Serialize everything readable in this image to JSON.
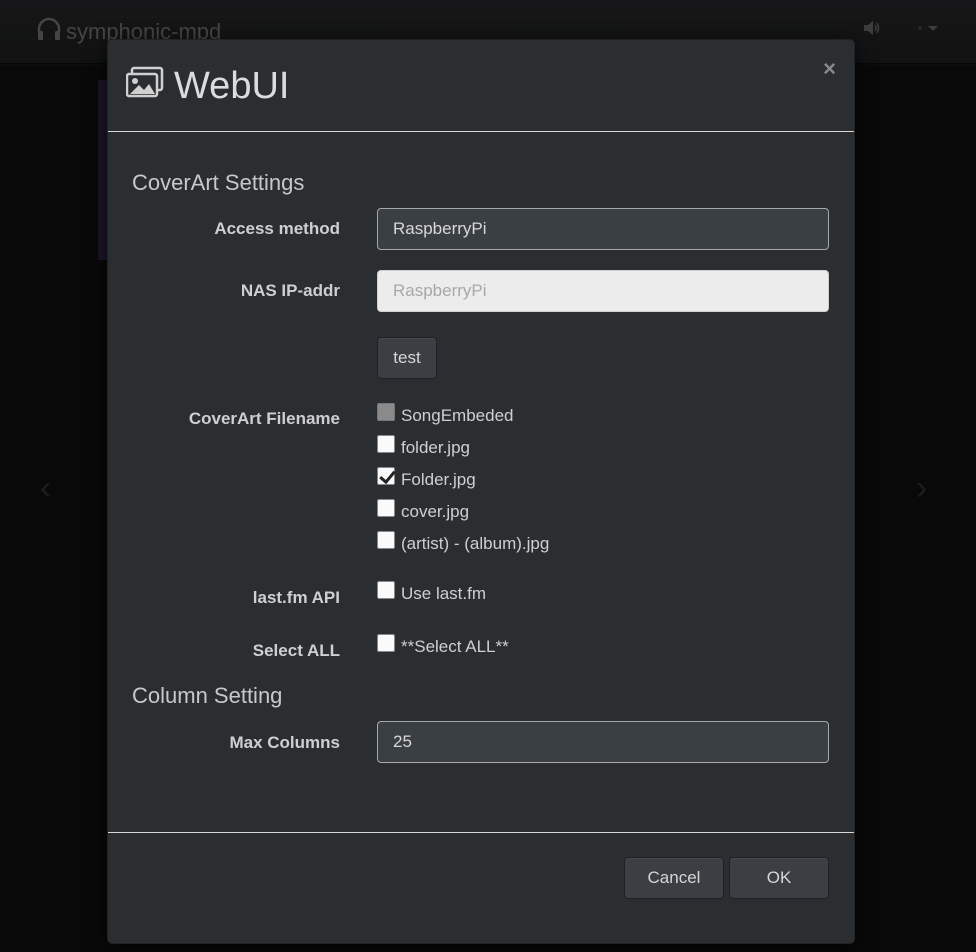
{
  "app": {
    "brand": "symphonic-mpd",
    "icons": [
      "headphones-icon",
      "volume-icon",
      "gear-icon"
    ]
  },
  "modal": {
    "title": "WebUI",
    "title_icon": "images-icon",
    "close_label": "×",
    "coverart_section": "CoverArt Settings",
    "access_method": {
      "label": "Access method",
      "value": "RaspberryPi"
    },
    "nas_ip": {
      "label": "NAS IP-addr",
      "placeholder": "RaspberryPi"
    },
    "test_button": "test",
    "coverart_filename": {
      "label": "CoverArt Filename",
      "options": [
        {
          "label": "SongEmbeded",
          "checked": false,
          "disabled": true
        },
        {
          "label": "folder.jpg",
          "checked": false,
          "disabled": false
        },
        {
          "label": "Folder.jpg",
          "checked": true,
          "disabled": false
        },
        {
          "label": "cover.jpg",
          "checked": false,
          "disabled": false
        },
        {
          "label": "(artist) - (album).jpg",
          "checked": false,
          "disabled": false
        }
      ]
    },
    "lastfm": {
      "label": "last.fm API",
      "option": "Use last.fm",
      "checked": false
    },
    "select_all": {
      "label": "Select ALL",
      "option": "**Select ALL**",
      "checked": false
    },
    "column_section": "Column Setting",
    "max_columns": {
      "label": "Max Columns",
      "value": "25"
    },
    "cancel_button": "Cancel",
    "ok_button": "OK"
  },
  "colors": {
    "modal_bg": "#2b2e31",
    "page_bg": "#121314",
    "divider": "#d6d6d6"
  }
}
